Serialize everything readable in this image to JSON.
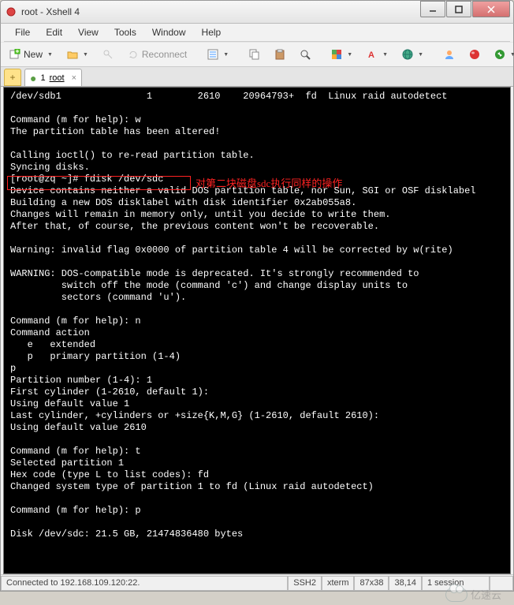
{
  "window": {
    "title": "root - Xshell 4"
  },
  "menu": {
    "file": "File",
    "edit": "Edit",
    "view": "View",
    "tools": "Tools",
    "window": "Window",
    "help": "Help"
  },
  "toolbar": {
    "new_label": "New",
    "reconnect_label": "Reconnect"
  },
  "tabs": {
    "add": "+",
    "items": [
      {
        "index": "1",
        "label": "root",
        "close": "×"
      }
    ]
  },
  "terminal": {
    "text": "/dev/sdb1               1        2610    20964793+  fd  Linux raid autodetect\n\nCommand (m for help): w\nThe partition table has been altered!\n\nCalling ioctl() to re-read partition table.\nSyncing disks.\n[root@zq ~]# fdisk /dev/sdc\nDevice contains neither a valid DOS partition table, nor Sun, SGI or OSF disklabel\nBuilding a new DOS disklabel with disk identifier 0x2ab055a8.\nChanges will remain in memory only, until you decide to write them.\nAfter that, of course, the previous content won't be recoverable.\n\nWarning: invalid flag 0x0000 of partition table 4 will be corrected by w(rite)\n\nWARNING: DOS-compatible mode is deprecated. It's strongly recommended to\n         switch off the mode (command 'c') and change display units to\n         sectors (command 'u').\n\nCommand (m for help): n\nCommand action\n   e   extended\n   p   primary partition (1-4)\np\nPartition number (1-4): 1\nFirst cylinder (1-2610, default 1):\nUsing default value 1\nLast cylinder, +cylinders or +size{K,M,G} (1-2610, default 2610):\nUsing default value 2610\n\nCommand (m for help): t\nSelected partition 1\nHex code (type L to list codes): fd\nChanged system type of partition 1 to fd (Linux raid autodetect)\n\nCommand (m for help): p\n\nDisk /dev/sdc: 21.5 GB, 21474836480 bytes",
    "annotation": "对第二块磁盘sdc执行同样的操作"
  },
  "status": {
    "connection": "Connected to 192.168.109.120:22.",
    "protocol": "SSH2",
    "term": "xterm",
    "size": "87x38",
    "cursor": "38,14",
    "sessions": "1 session"
  },
  "watermark": "亿速云"
}
